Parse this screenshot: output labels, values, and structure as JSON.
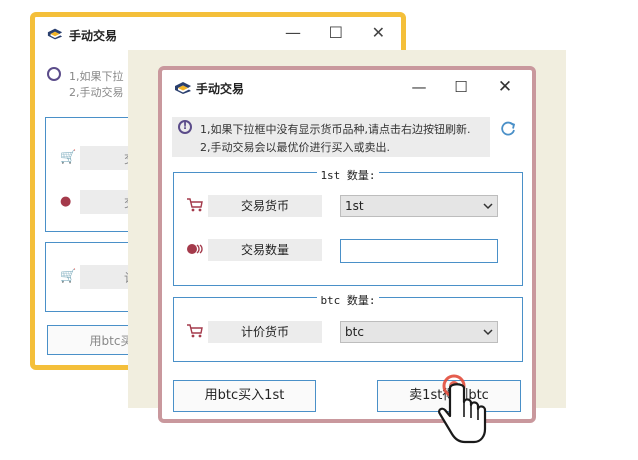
{
  "background_window": {
    "title": "手动交易",
    "controls": {
      "minimize": "—",
      "maximize": "☐",
      "close": "✕"
    },
    "notice_lines": [
      "1,如果下拉",
      "2,手动交易"
    ],
    "row_labels": [
      "交易",
      "交易",
      "计价"
    ],
    "button_label": "用btc买入"
  },
  "window": {
    "title": "手动交易",
    "controls": {
      "minimize": "—",
      "maximize": "☐",
      "close": "✕"
    }
  },
  "notice": {
    "line1": "1,如果下拉框中没有显示货币品种,请点击右边按钮刷新.",
    "line2": "2,手动交易会以最优价进行买入或卖出."
  },
  "group1": {
    "legend": "1st 数量:",
    "currency_label": "交易货币",
    "currency_value": "1st",
    "amount_label": "交易数量",
    "amount_value": ""
  },
  "group2": {
    "legend": "btc 数量:",
    "quote_label": "计价货币",
    "quote_value": "btc"
  },
  "actions": {
    "buy_label": "用btc买入1st",
    "sell_label": "卖1st得到btc"
  },
  "colors": {
    "accent_border": "#4a90c8",
    "window_frame": "#c9989d",
    "bg_window_frame": "#f4bf3a",
    "icon_red": "#a43a4b"
  },
  "icons": {
    "app": "app-logo-icon",
    "notice": "info-icon",
    "refresh": "refresh-icon",
    "cart": "cart-icon",
    "coins": "coins-icon",
    "dropdown": "chevron-down-icon",
    "pointer": "hand-pointer-icon"
  }
}
